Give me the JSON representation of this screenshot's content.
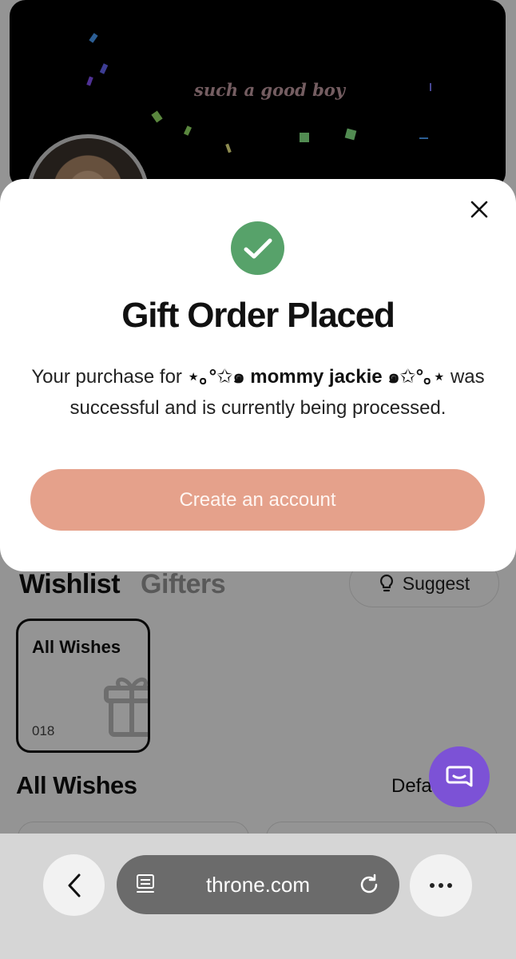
{
  "banner": {
    "text": "such a good boy"
  },
  "modal": {
    "title": "Gift Order Placed",
    "message_prefix": "Your purchase for",
    "recipient": "⋆｡°✩๑ mommy jackie ๑✩°｡⋆",
    "message_suffix": "was successful and is currently being processed.",
    "cta_label": "Create an account",
    "success_color": "#57a26a",
    "cta_color": "#e5a18b"
  },
  "tabs": {
    "wishlist": "Wishlist",
    "gifters": "Gifters"
  },
  "suggest_button": {
    "label": "Suggest"
  },
  "wish_card": {
    "title": "All Wishes",
    "count": "018"
  },
  "section": {
    "title": "All Wishes",
    "sort_label": "Default"
  },
  "browser": {
    "url": "throne.com"
  },
  "colors": {
    "chat_fab": "#7c52d6",
    "overlay": "rgba(0,0,0,0.42)"
  }
}
